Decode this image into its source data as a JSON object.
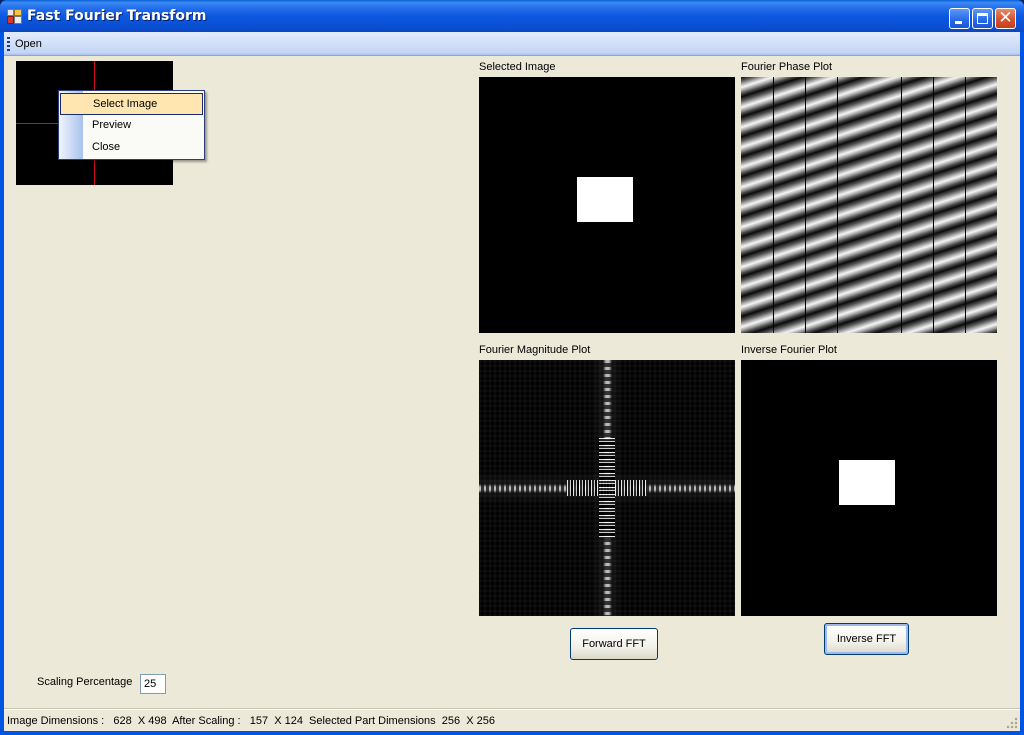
{
  "window": {
    "title": "Fast Fourier Transform",
    "controls": {
      "minimize": "minimize",
      "maximize": "maximize",
      "close": "✕"
    }
  },
  "menubar": {
    "items": [
      {
        "label": "Open"
      }
    ]
  },
  "context_menu": {
    "items": [
      {
        "label": "Select Image",
        "highlighted": true
      },
      {
        "label": "Preview",
        "highlighted": false
      },
      {
        "label": "Close",
        "highlighted": false
      }
    ]
  },
  "panels": {
    "selected_image": {
      "label": "Selected Image"
    },
    "phase_plot": {
      "label": "Fourier Phase Plot"
    },
    "magnitude_plot": {
      "label": "Fourier Magnitude Plot"
    },
    "inverse_plot": {
      "label": "Inverse Fourier  Plot"
    }
  },
  "buttons": {
    "forward_fft": "Forward FFT",
    "inverse_fft": "Inverse FFT"
  },
  "scaling": {
    "label": "Scaling Percentage",
    "value": "25"
  },
  "statusbar": {
    "text": "Image Dimensions :   628  X 498  After Scaling :   157  X 124  Selected Part Dimensions  256  X 256",
    "image_dimensions": "628  X 498",
    "after_scaling": "157  X 124",
    "selected_part_dimensions": "256  X 256"
  },
  "colors": {
    "titlebar": "#0054e3",
    "window_bg": "#ece9d8",
    "crosshair": "#d01010",
    "menu_highlight": "#ffe6b0"
  }
}
